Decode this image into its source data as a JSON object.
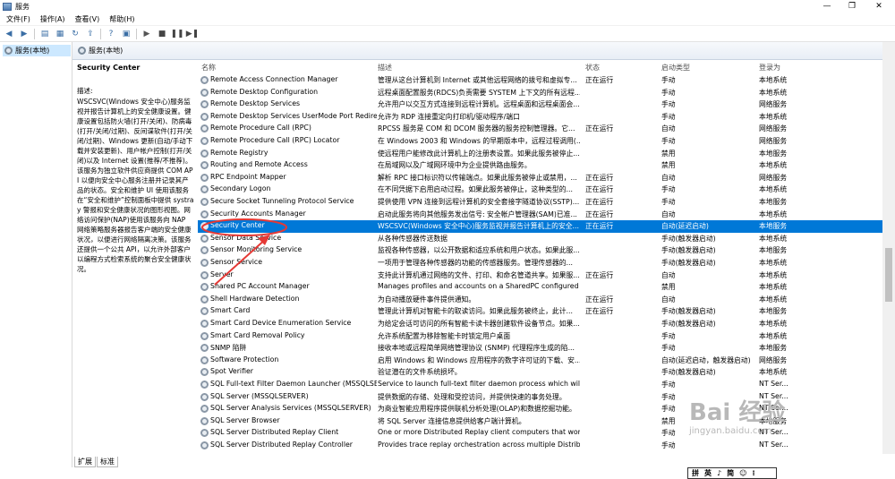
{
  "window": {
    "title": "服务",
    "controls": [
      "—",
      "❐",
      "✕"
    ]
  },
  "menu": [
    "文件(F)",
    "操作(A)",
    "查看(V)",
    "帮助(H)"
  ],
  "tree": {
    "root": "服务(本地)"
  },
  "panel": {
    "header": "服务(本地)"
  },
  "description": {
    "name": "Security Center",
    "label": "描述:",
    "text": "WSCSVC(Windows 安全中心)服务监视并报告计算机上的安全健康设置。健康设置包括防火墙(打开/关闭)、防病毒(打开/关闭/过期)、反间谍软件(打开/关闭/过期)、Windows 更新(自动/手动下载并安装更新)、用户帐户控制(打开/关闭)以及 Internet 设置(推荐/不推荐)。该服务为独立软件供应商提供 COM API 以便向安全中心服务注册并记录其产品的状态。安全和维护 UI 使用该服务在“安全和维护”控制面板中提供 systray 警报和安全健康状况的图形视图。网络访问保护(NAP)使用该服务向 NAP 网络策略服务器报告客户端的安全健康状况，以便进行网络隔离决策。该服务还提供一个公共 API，以允许外部客户以编程方式检索系统的聚合安全健康状况。"
  },
  "columns": {
    "name": "名称",
    "desc": "描述",
    "status": "状态",
    "startup": "启动类型",
    "logon": "登录为"
  },
  "services": [
    {
      "name": "Remote Access Connection Manager",
      "desc": "管理从这台计算机到 Internet 或其他远程网络的拨号和虚拟专...",
      "status": "正在运行",
      "startup": "手动",
      "logon": "本地系统"
    },
    {
      "name": "Remote Desktop Configuration",
      "desc": "远程桌面配置服务(RDCS)负责需要 SYSTEM 上下文的所有远程...",
      "status": "",
      "startup": "手动",
      "logon": "本地系统"
    },
    {
      "name": "Remote Desktop Services",
      "desc": "允许用户以交互方式连接到远程计算机。远程桌面和远程桌面会...",
      "status": "",
      "startup": "手动",
      "logon": "网络服务"
    },
    {
      "name": "Remote Desktop Services UserMode Port Redirec...",
      "desc": "允许为 RDP 连接重定向打印机/驱动程序/端口",
      "status": "",
      "startup": "手动",
      "logon": "本地系统"
    },
    {
      "name": "Remote Procedure Call (RPC)",
      "desc": "RPCSS 服务是 COM 和 DCOM 服务器的服务控制管理器。它...",
      "status": "正在运行",
      "startup": "自动",
      "logon": "网络服务"
    },
    {
      "name": "Remote Procedure Call (RPC) Locator",
      "desc": "在 Windows 2003 和 Windows 的早期版本中，远程过程调用(...",
      "status": "",
      "startup": "手动",
      "logon": "网络服务"
    },
    {
      "name": "Remote Registry",
      "desc": "使远程用户能修改此计算机上的注册表设置。如果此服务被停止...",
      "status": "",
      "startup": "禁用",
      "logon": "本地服务"
    },
    {
      "name": "Routing and Remote Access",
      "desc": "在局域网以及广域网环境中为企业提供路由服务。",
      "status": "",
      "startup": "禁用",
      "logon": "本地系统"
    },
    {
      "name": "RPC Endpoint Mapper",
      "desc": "解析 RPC 接口标识符以传输端点。如果此服务被停止或禁用，...",
      "status": "正在运行",
      "startup": "自动",
      "logon": "网络服务"
    },
    {
      "name": "Secondary Logon",
      "desc": "在不同凭据下启用启动过程。如果此服务被停止，这种类型的...",
      "status": "正在运行",
      "startup": "手动",
      "logon": "本地系统"
    },
    {
      "name": "Secure Socket Tunneling Protocol Service",
      "desc": "提供使用 VPN 连接到远程计算机的安全套接字隧道协议(SSTP)...",
      "status": "正在运行",
      "startup": "手动",
      "logon": "本地服务"
    },
    {
      "name": "Security Accounts Manager",
      "desc": "启动此服务将向其他服务发出信号: 安全帐户管理器(SAM)已准...",
      "status": "正在运行",
      "startup": "自动",
      "logon": "本地系统"
    },
    {
      "name": "Security Center",
      "desc": "WSCSVC(Windows 安全中心)服务监视并报告计算机上的安全...",
      "status": "正在运行",
      "startup": "自动(延迟启动)",
      "logon": "本地服务"
    },
    {
      "name": "Sensor Data Service",
      "desc": "从各种传感器传送数据",
      "status": "",
      "startup": "手动(触发器启动)",
      "logon": "本地系统"
    },
    {
      "name": "Sensor Monitoring Service",
      "desc": "监视各种传感器，以公开数据和适应系统和用户状态。如果此服...",
      "status": "",
      "startup": "手动(触发器启动)",
      "logon": "本地服务"
    },
    {
      "name": "Sensor Service",
      "desc": "一项用于管理各种传感器的功能的传感器服务。管理传感器的...",
      "status": "",
      "startup": "手动(触发器启动)",
      "logon": "本地系统"
    },
    {
      "name": "Server",
      "desc": "支持此计算机通过网络的文件、打印、和命名管道共享。如果服...",
      "status": "正在运行",
      "startup": "自动",
      "logon": "本地系统"
    },
    {
      "name": "Shared PC Account Manager",
      "desc": "Manages profiles and accounts on a SharedPC configured dev...",
      "status": "",
      "startup": "禁用",
      "logon": "本地系统"
    },
    {
      "name": "Shell Hardware Detection",
      "desc": "为自动播放硬件事件提供通知。",
      "status": "正在运行",
      "startup": "自动",
      "logon": "本地系统"
    },
    {
      "name": "Smart Card",
      "desc": "管理此计算机对智能卡的取读访问。如果此服务被终止，此计...",
      "status": "正在运行",
      "startup": "手动(触发器启动)",
      "logon": "本地服务"
    },
    {
      "name": "Smart Card Device Enumeration Service",
      "desc": "为给定会话可访问的所有智能卡读卡器创建软件设备节点。如果...",
      "status": "",
      "startup": "手动(触发器启动)",
      "logon": "本地系统"
    },
    {
      "name": "Smart Card Removal Policy",
      "desc": "允许系统配置为移除智能卡时锁定用户桌面",
      "status": "",
      "startup": "手动",
      "logon": "本地系统"
    },
    {
      "name": "SNMP 陷阱",
      "desc": "接收本地或远程简单网络管理协议 (SNMP) 代理程序生成的陷...",
      "status": "",
      "startup": "手动",
      "logon": "本地服务"
    },
    {
      "name": "Software Protection",
      "desc": "启用 Windows 和 Windows 应用程序的数字许可证的下载、安...",
      "status": "",
      "startup": "自动(延迟启动，触发器启动)",
      "logon": "网络服务"
    },
    {
      "name": "Spot Verifier",
      "desc": "验证潜在的文件系统损坏。",
      "status": "",
      "startup": "手动(触发器启动)",
      "logon": "本地系统"
    },
    {
      "name": "SQL Full-text Filter Daemon Launcher (MSSQLSE...",
      "desc": "Service to launch full-text filter daemon process which will pe...",
      "status": "",
      "startup": "手动",
      "logon": "NT Ser..."
    },
    {
      "name": "SQL Server (MSSQLSERVER)",
      "desc": "提供数据的存储、处理和受控访问，并提供快速的事务处理。",
      "status": "",
      "startup": "手动",
      "logon": "NT Ser..."
    },
    {
      "name": "SQL Server Analysis Services (MSSQLSERVER)",
      "desc": "为商业智能应用程序提供联机分析处理(OLAP)和数据挖掘功能。",
      "status": "",
      "startup": "手动",
      "logon": "NT Ser..."
    },
    {
      "name": "SQL Server Browser",
      "desc": "将 SQL Server 连接信息提供给客户端计算机。",
      "status": "",
      "startup": "禁用",
      "logon": "本地服务"
    },
    {
      "name": "SQL Server Distributed Replay Client",
      "desc": "One or more Distributed Replay client computers that work to...",
      "status": "",
      "startup": "手动",
      "logon": "NT Ser..."
    },
    {
      "name": "SQL Server Distributed Replay Controller",
      "desc": "Provides trace replay orchestration across multiple Distributed...",
      "status": "",
      "startup": "手动",
      "logon": "NT Ser..."
    }
  ],
  "tabs": [
    "扩展",
    "标准"
  ],
  "ime": [
    "拼",
    "英",
    "♪",
    "简",
    "☺",
    "⁝"
  ],
  "watermark": {
    "logo": "Bai 经验",
    "url": "jingyan.baidu.com"
  },
  "colors": {
    "selection": "#0078d7",
    "annotation": "#e53935"
  }
}
